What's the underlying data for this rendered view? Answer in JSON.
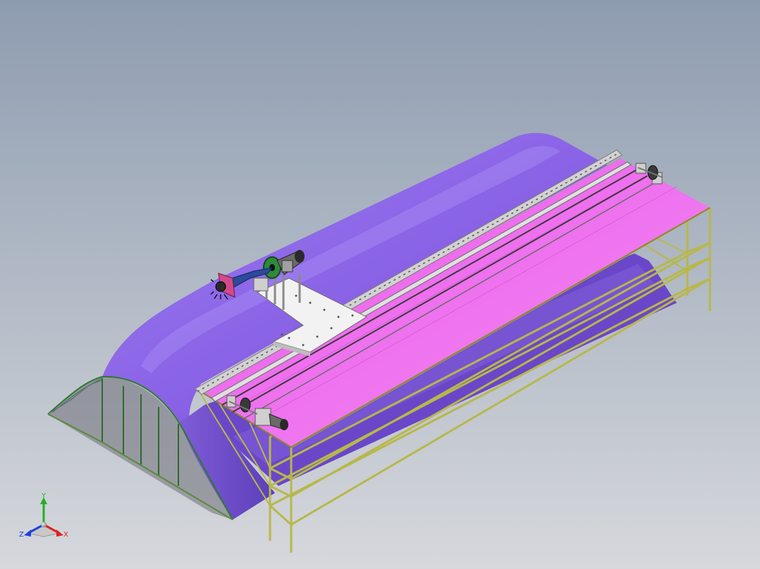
{
  "view": {
    "background_top": "#8e9cb0",
    "background_bottom": "#d6d8dc",
    "colors": {
      "greenhouse_cover": "#8a63e6",
      "greenhouse_cover_light": "#a487f2",
      "greenhouse_cover_shade": "#5c3fb8",
      "table_top": "#ef6bf0",
      "table_top_light": "#f590f5",
      "rail": "#c9c9c9",
      "frame": "#b7b84a",
      "frame_dark": "#8a8a2c",
      "carriage_plate": "#f1f1f1",
      "arm": "#2b4a9a",
      "wheel": "#2e8a3a",
      "motor": "#5a5a5a",
      "bracket": "#d24a8a"
    }
  },
  "triad": {
    "x_label": "X",
    "y_label": "Y",
    "z_label": "Z",
    "x_color": "#e02020",
    "y_color": "#20b020",
    "z_color": "#2040e0"
  }
}
